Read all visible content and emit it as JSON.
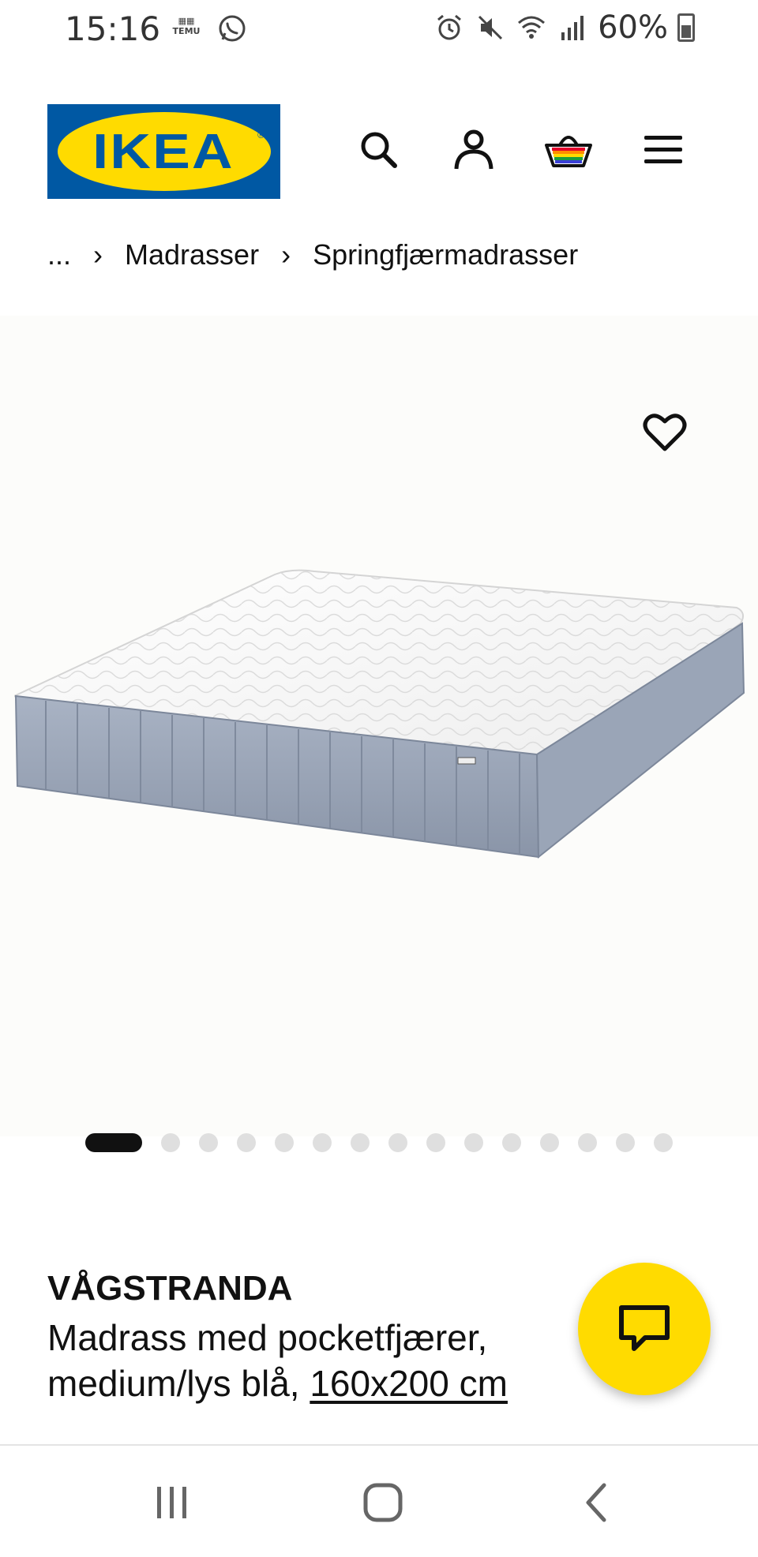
{
  "status_bar": {
    "time": "15:16",
    "temu_label": "TEMU",
    "battery_percent": "60%",
    "icons": [
      "whatsapp-icon",
      "alarm-icon",
      "mute-icon",
      "wifi-icon",
      "signal-icon",
      "battery-icon"
    ]
  },
  "header": {
    "logo_text": "IKEA",
    "logo_reg": "®",
    "brand_colors": {
      "blue": "#0058a3",
      "yellow": "#ffdb00"
    },
    "actions": [
      "search-icon",
      "account-icon",
      "basket-icon",
      "menu-icon"
    ]
  },
  "breadcrumb": {
    "items": [
      "...",
      "Madrasser",
      "Springfjærmadrasser"
    ]
  },
  "carousel": {
    "count": 16,
    "active_index": 0
  },
  "product": {
    "name": "VÅGSTRANDA",
    "description": "Madrass med pocketfjærer, medium/lys blå,",
    "size": "160x200 cm"
  },
  "chat": {
    "icon": "chat-icon",
    "color": "#ffdb00"
  },
  "nav": [
    "recents-icon",
    "home-icon",
    "back-icon"
  ]
}
